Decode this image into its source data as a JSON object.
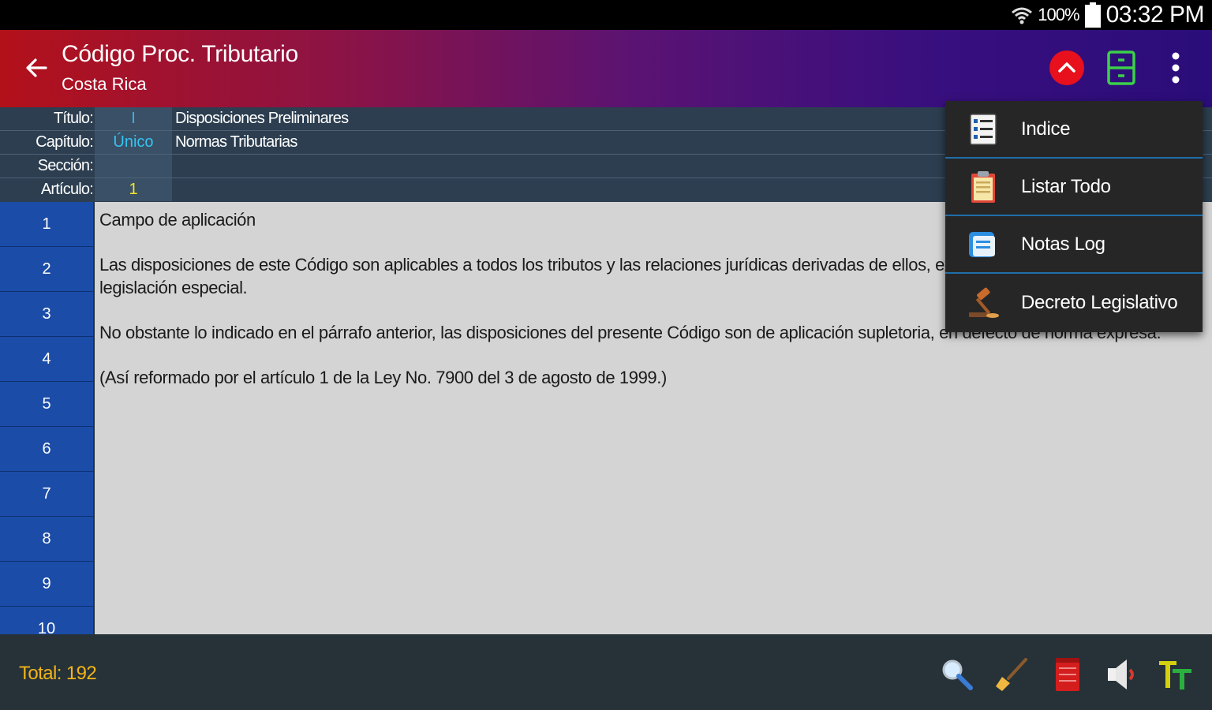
{
  "status_bar": {
    "battery": "100%",
    "time": "03:32 PM"
  },
  "app_bar": {
    "title": "Código Proc. Tributario",
    "subtitle": "Costa Rica"
  },
  "info": {
    "rows": [
      {
        "label": "Título:",
        "number": "I",
        "value": "Disposiciones Preliminares",
        "number_color": "#35b5f0"
      },
      {
        "label": "Capítulo:",
        "number": "Único",
        "value": "Normas Tributarias",
        "number_color": "#35c4f0"
      },
      {
        "label": "Sección:",
        "number": "",
        "value": "",
        "number_color": "#ffffff"
      },
      {
        "label": "Artículo:",
        "number": "1",
        "value": "",
        "number_color": "#f5e623"
      }
    ]
  },
  "numbers": [
    "1",
    "2",
    "3",
    "4",
    "5",
    "6",
    "7",
    "8",
    "9",
    "10"
  ],
  "content": {
    "paragraphs": [
      "Campo de aplicación",
      "Las disposiciones de este Código son aplicables a todos los tributos y las relaciones jurídicas derivadas de ellos, excepto lo regulado por la legislación especial.",
      "No obstante lo indicado en el párrafo anterior, las disposiciones del presente Código son de aplicación supletoria, en defecto de norma expresa.",
      "(Así reformado por el artículo 1 de la Ley No. 7900 del 3 de agosto de 1999.)"
    ]
  },
  "menu": {
    "items": [
      {
        "label": "Indice",
        "icon": "index-list-icon"
      },
      {
        "label": "Listar Todo",
        "icon": "clipboard-icon"
      },
      {
        "label": "Notas Log",
        "icon": "notes-icon"
      },
      {
        "label": "Decreto Legislativo",
        "icon": "gavel-icon"
      }
    ]
  },
  "bottom_bar": {
    "total": "Total: 192",
    "tools": [
      "search-icon",
      "broom-icon",
      "notepad-icon",
      "speaker-icon",
      "text-size-icon"
    ]
  },
  "colors": {
    "accent_red": "#e8101c",
    "total_text": "#f2b418",
    "number_column": "#1b4ca8"
  }
}
